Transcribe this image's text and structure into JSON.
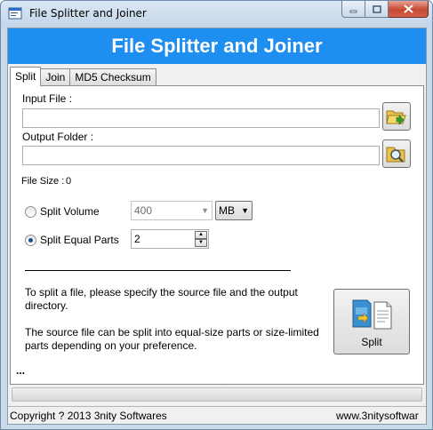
{
  "window": {
    "title": "File Splitter and Joiner"
  },
  "banner": {
    "title": "File Splitter and Joiner"
  },
  "tabs": [
    {
      "label": "Split",
      "active": true
    },
    {
      "label": "Join",
      "active": false
    },
    {
      "label": "MD5 Checksum",
      "active": false
    }
  ],
  "split": {
    "input_file_label": "Input File :",
    "input_file_value": "",
    "output_folder_label": "Output Folder :",
    "output_folder_value": "",
    "file_size_label": "File Size :",
    "file_size_value": "0",
    "split_volume_label": "Split Volume",
    "split_volume_selected": false,
    "volume_value": "400",
    "volume_unit": "MB",
    "split_equal_label": "Split Equal Parts",
    "split_equal_selected": true,
    "equal_parts_value": "2",
    "info_line1": "To split a file, please specify the source file and the output directory.",
    "info_line2": "The source file can be split into equal-size parts or size-limited parts depending on your preference.",
    "split_button_label": "Split",
    "ellipsis": "..."
  },
  "status": {
    "copyright": "Copyright ? 2013 3nity Softwares",
    "website": "www.3nitysoftwar"
  },
  "icons": {
    "app": "file-splitter-icon",
    "browse_input": "folder-open-icon",
    "browse_output": "magnifier-folder-icon",
    "split": "split-file-icon"
  },
  "colors": {
    "banner": "#1e8ef0",
    "window_frame": "#c9d9ea"
  }
}
